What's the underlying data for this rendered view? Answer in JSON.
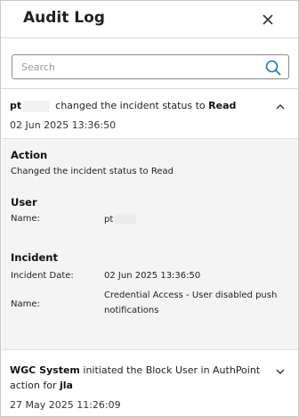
{
  "header": {
    "title": "Audit Log",
    "close_icon": "close-icon"
  },
  "search": {
    "placeholder": "Search",
    "value": "",
    "icon": "search-icon"
  },
  "entries": [
    {
      "actor": "pt",
      "action_text": "changed the incident status to",
      "status": "Read",
      "timestamp": "02 Jun 2025 13:36:50",
      "expanded": true,
      "details": {
        "action_heading": "Action",
        "action_value": "Changed the incident status to  Read",
        "user_heading": "User",
        "user_name_label": "Name:",
        "user_name_value": "pt",
        "incident_heading": "Incident",
        "incident_date_label": "Incident Date:",
        "incident_date_value": "02 Jun 2025 13:36:50",
        "incident_name_label": "Name:",
        "incident_name_value": "Credential Access - User disabled push notifications"
      }
    },
    {
      "actor": "WGC System",
      "action_text": "initiated the Block User in AuthPoint",
      "action_text2": "action for",
      "target": "jla",
      "timestamp": "27 May 2025 11:26:09",
      "expanded": false
    }
  ]
}
